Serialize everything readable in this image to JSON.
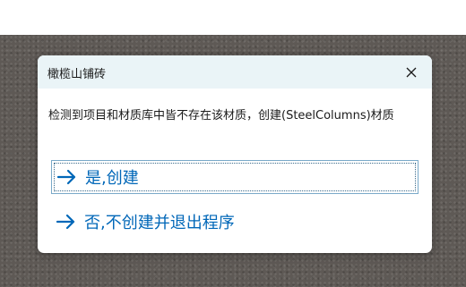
{
  "dialog": {
    "title": "橄榄山铺砖",
    "message": "检测到项目和材质库中皆不存在该材质，创建(SteelColumns)材质",
    "commands": [
      {
        "label": "是,创建"
      },
      {
        "label": "否,不创建并退出程序"
      }
    ]
  },
  "colors": {
    "accent": "#0067b8",
    "titlebar": "#eaf4f7"
  },
  "icons": {
    "close": "close-icon",
    "command": "right-arrow-icon"
  }
}
